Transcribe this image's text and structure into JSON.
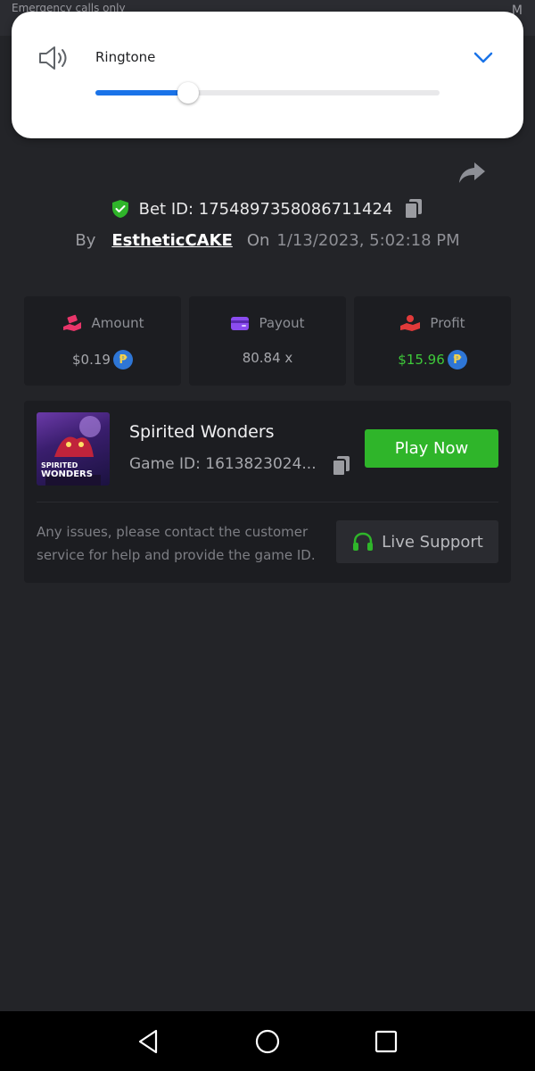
{
  "status_bar": {
    "carrier_text": "Emergency calls only",
    "clock_text": "M"
  },
  "volume_panel": {
    "stream_label": "Ringtone",
    "level_percent": 27,
    "icon": "speaker-icon",
    "accent_color": "#1a73e8"
  },
  "bet": {
    "id_text": "Bet ID: 1754897358086711424",
    "by_label": "By",
    "username": "EstheticCAKE",
    "on_label": "On",
    "datetime": "1/13/2023, 5:02:18 PM"
  },
  "stats": [
    {
      "label": "Amount",
      "value": "$0.19",
      "icon": "money-hand-icon",
      "icon_color": "#e8356a",
      "value_color": "#a6a7ac",
      "has_coin": true
    },
    {
      "label": "Payout",
      "value": "80.84 x",
      "icon": "wallet-icon",
      "icon_color": "#8b4cf0",
      "value_color": "#a6a7ac",
      "has_coin": false
    },
    {
      "label": "Profit",
      "value": "$15.96",
      "icon": "profit-hand-icon",
      "icon_color": "#e23a3a",
      "value_color": "#3ec93a",
      "has_coin": true
    }
  ],
  "coin_symbol": "₱",
  "game": {
    "title": "Spirited Wonders",
    "game_id": "Game ID: 1613823024...",
    "thumb_line1": "SPIRITED",
    "thumb_line2": "WONDERS",
    "play_label": "Play Now",
    "issues_text": "Any issues, please contact the customer service for help and provide the game ID.",
    "support_label": "Live Support",
    "play_color": "#2fb52a"
  }
}
